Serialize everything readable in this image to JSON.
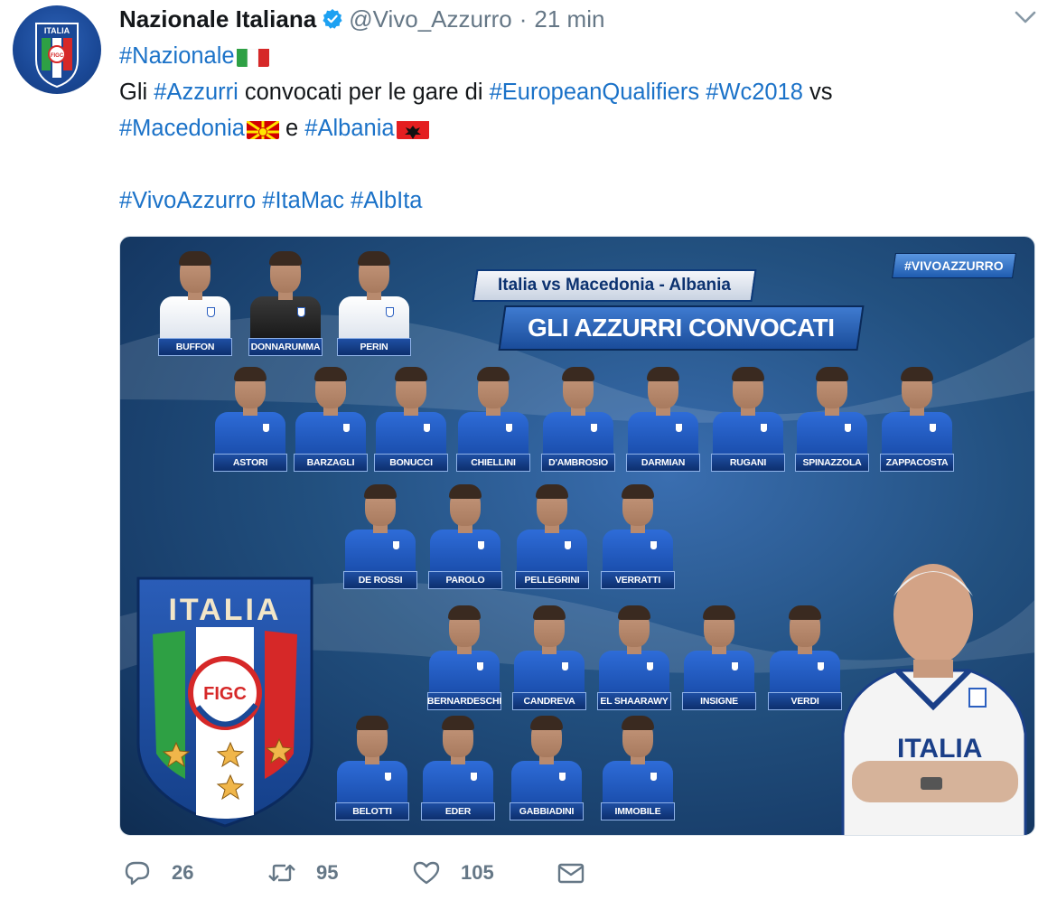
{
  "author": {
    "name": "Nazionale Italiana",
    "handle": "@Vivo_Azzurro",
    "separator": "·",
    "time": "21 min",
    "avatar_text": "ITALIA",
    "avatar_sub": "FIGC"
  },
  "tweet": {
    "line1_tag": "#Nazionale",
    "line2_pre": "Gli ",
    "line2_tag1": "#Azzurri",
    "line2_mid": " convocati per le gare di ",
    "line2_tag2": "#EuropeanQualifiers",
    "line2_space": " ",
    "line2_tag3": "#Wc2018",
    "line2_post": " vs",
    "line3_tag1": "#Macedonia",
    "line3_mid": " e ",
    "line3_tag2": "#Albania",
    "line5_tag1": "#VivoAzzurro",
    "line5_tag2": "#ItaMac",
    "line5_tag3": "#AlbIta"
  },
  "image": {
    "hashtag": "#VIVOAZZURRO",
    "subtitle": "Italia vs Macedonia - Albania",
    "title": "GLI AZZURRI CONVOCATI",
    "crest_word": "ITALIA",
    "crest_figc": "FIGC",
    "coach_shirt": "ITALIA",
    "goalkeepers": [
      "BUFFON",
      "DONNARUMMA",
      "PERIN"
    ],
    "defenders": [
      "ASTORI",
      "BARZAGLI",
      "BONUCCI",
      "CHIELLINI",
      "D'AMBROSIO",
      "DARMIAN",
      "RUGANI",
      "SPINAZZOLA",
      "ZAPPACOSTA"
    ],
    "midfielders": [
      "DE ROSSI",
      "PAROLO",
      "PELLEGRINI",
      "VERRATTI"
    ],
    "wingers": [
      "BERNARDESCHI",
      "CANDREVA",
      "EL SHAARAWY",
      "INSIGNE",
      "VERDI"
    ],
    "forwards": [
      "BELOTTI",
      "EDER",
      "GABBIADINI",
      "IMMOBILE"
    ]
  },
  "actions": {
    "reply_count": "26",
    "retweet_count": "95",
    "like_count": "105"
  },
  "icons": {
    "verified": "verified-badge-icon",
    "caret": "chevron-down-icon",
    "reply": "reply-icon",
    "retweet": "retweet-icon",
    "like": "heart-icon",
    "dm": "envelope-icon"
  },
  "colors": {
    "hashtag": "#1b72c8",
    "secondary_text": "#657786",
    "verified": "#1da1f2"
  }
}
